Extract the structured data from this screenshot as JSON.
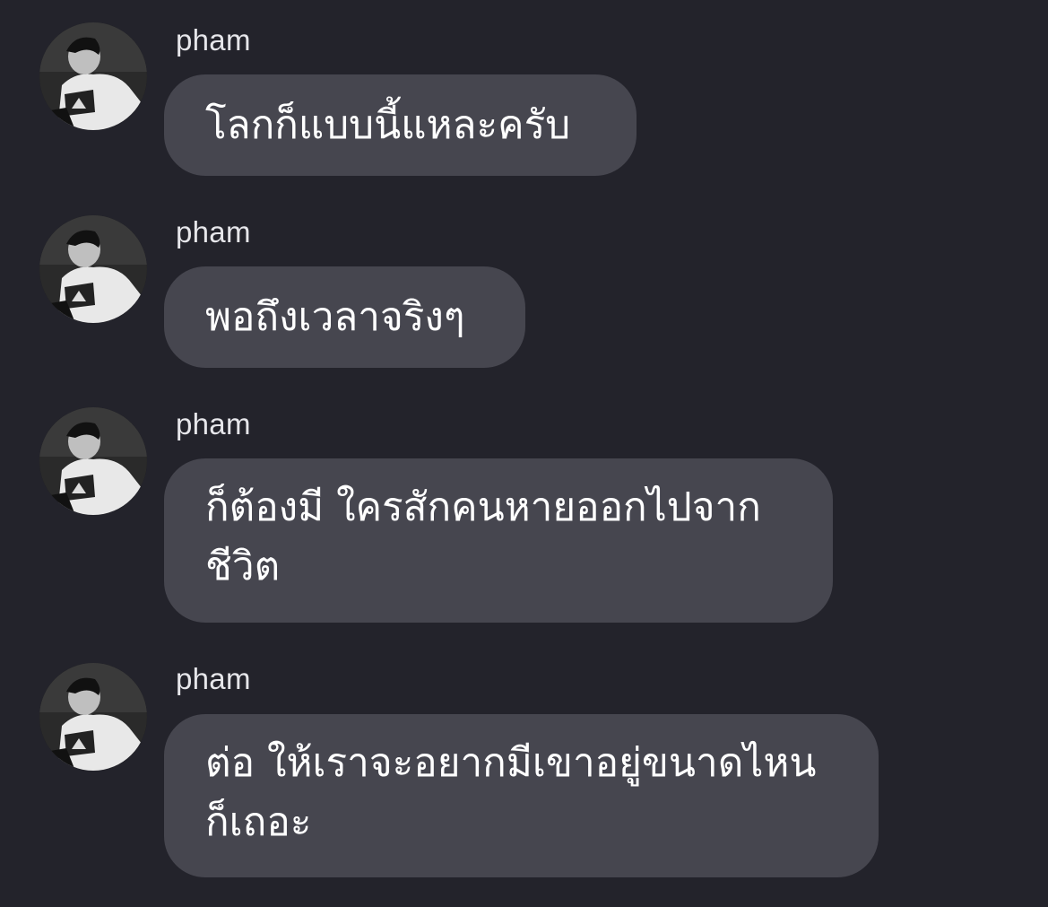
{
  "conversation": {
    "messages": [
      {
        "sender": "pham",
        "avatar_icon": "user-photo-avatar",
        "text": "โลกก็แบบนี้แหละครับ"
      },
      {
        "sender": "pham",
        "avatar_icon": "user-photo-avatar",
        "text": "พอถึงเวลาจริงๆ"
      },
      {
        "sender": "pham",
        "avatar_icon": "user-photo-avatar",
        "text": "ก็ต้องมี ใครสักคนหายออกไปจาก\nชีวิต"
      },
      {
        "sender": "pham",
        "avatar_icon": "user-photo-avatar",
        "text": "ต่อ ให้เราจะอยากมีเขาอยู่ขนาดไหน\nก็เถอะ"
      }
    ]
  },
  "colors": {
    "background": "#23232b",
    "bubble": "#46464f",
    "bubble_text": "#ffffff",
    "sender_text": "#e6e6ea"
  }
}
